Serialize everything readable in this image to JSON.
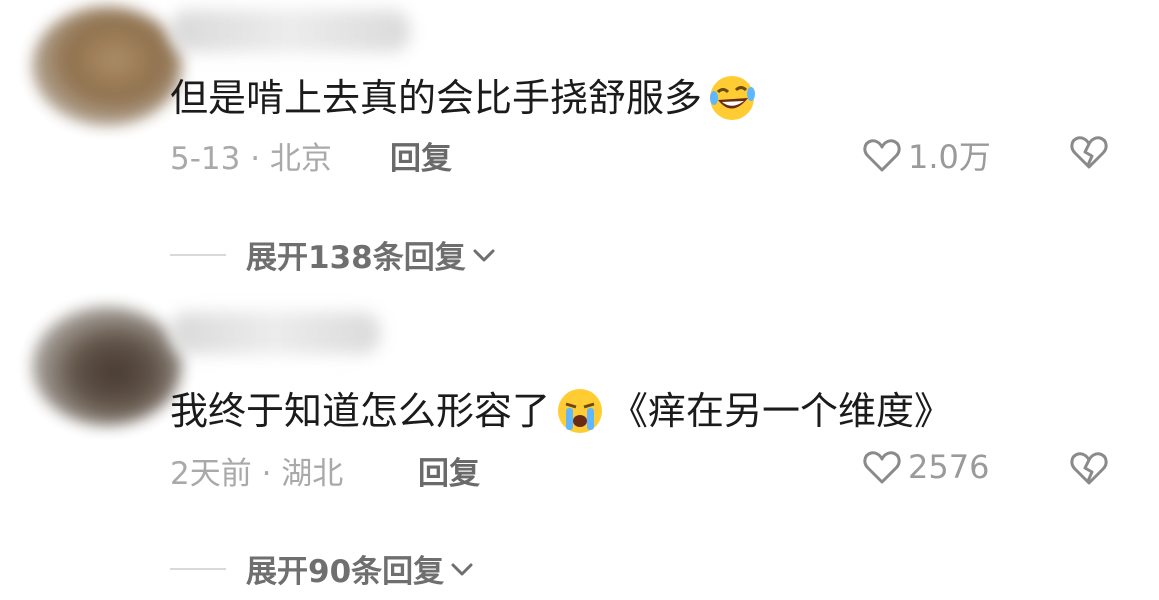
{
  "comments": [
    {
      "text": "但是啃上去真的会比手挠舒服多",
      "text_after": "",
      "emoji": "rofl-emoji",
      "meta": "5-13 · 北京",
      "reply_label": "回复",
      "likes": "1.0万",
      "expand_label": "展开138条回复"
    },
    {
      "text": "我终于知道怎么形容了",
      "text_after": "《痒在另一个维度》",
      "emoji": "crying-emoji",
      "meta": "2天前 · 湖北",
      "reply_label": "回复",
      "likes": "2576",
      "expand_label": "展开90条回复"
    }
  ]
}
